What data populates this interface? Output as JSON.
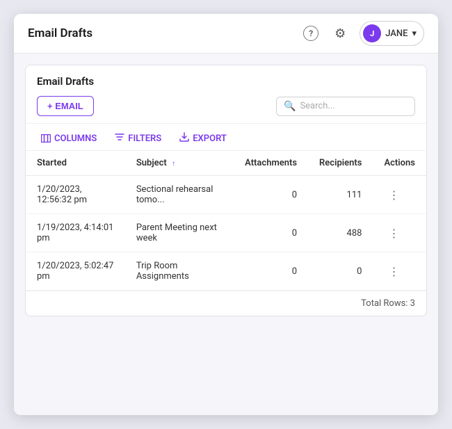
{
  "titleBar": {
    "title": "Email Drafts",
    "helpLabel": "?",
    "settingsLabel": "⚙",
    "user": {
      "initials": "J",
      "name": "JANE",
      "chevron": "▾"
    }
  },
  "panel": {
    "title": "Email Drafts",
    "emailButton": "+ EMAIL",
    "search": {
      "placeholder": "Search..."
    },
    "toolbar": {
      "columns": "COLUMNS",
      "filters": "FILTERS",
      "export": "EXPORT"
    },
    "table": {
      "columns": [
        {
          "key": "started",
          "label": "Started",
          "sortable": false
        },
        {
          "key": "subject",
          "label": "Subject",
          "sortable": true
        },
        {
          "key": "attachments",
          "label": "Attachments",
          "sortable": false
        },
        {
          "key": "recipients",
          "label": "Recipients",
          "sortable": false
        },
        {
          "key": "actions",
          "label": "Actions",
          "sortable": false
        }
      ],
      "rows": [
        {
          "started": "1/20/2023, 12:56:32 pm",
          "subject": "Sectional rehearsal tomo...",
          "attachments": "0",
          "recipients": "111"
        },
        {
          "started": "1/19/2023, 4:14:01 pm",
          "subject": "Parent Meeting next week",
          "attachments": "0",
          "recipients": "488"
        },
        {
          "started": "1/20/2023, 5:02:47 pm",
          "subject": "Trip Room Assignments",
          "attachments": "0",
          "recipients": "0"
        }
      ]
    },
    "footer": {
      "totalRows": "Total Rows: 3"
    }
  }
}
